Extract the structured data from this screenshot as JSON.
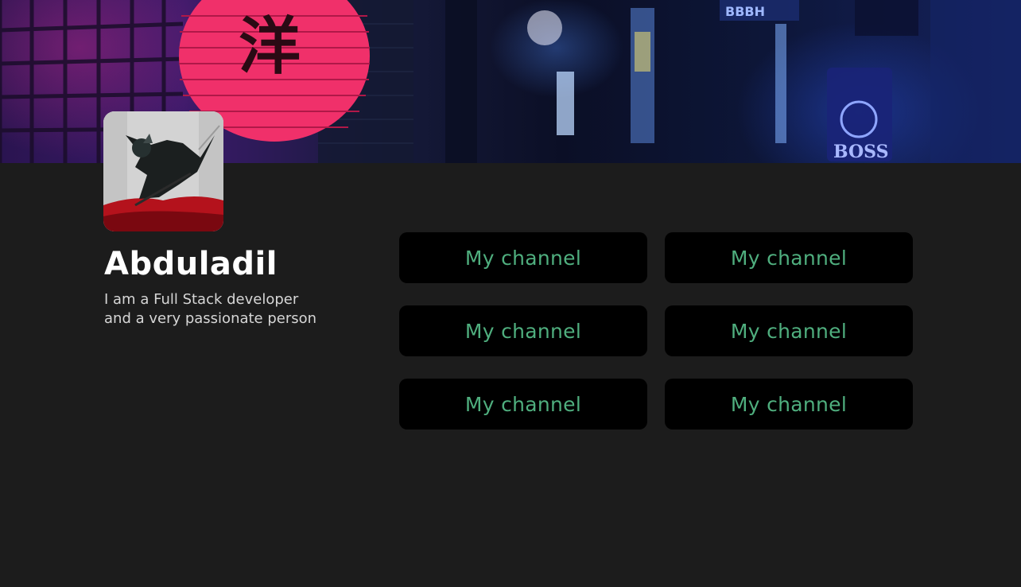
{
  "banner": {
    "lantern_glyph": "洋",
    "sign_text": "BOSS",
    "sign_top_text": "BBBH"
  },
  "profile": {
    "name": "Abduladil",
    "bio_lines": [
      "I am a Full Stack developer",
      "and a very passionate person"
    ]
  },
  "channels": [
    {
      "label": "My channel"
    },
    {
      "label": "My channel"
    },
    {
      "label": "My channel"
    },
    {
      "label": "My channel"
    },
    {
      "label": "My channel"
    },
    {
      "label": "My channel"
    }
  ],
  "colors": {
    "background": "#1c1c1c",
    "button_bg": "#000000",
    "button_text": "#4fae7e",
    "name_text": "#ffffff",
    "bio_text": "#d6d6d6"
  }
}
